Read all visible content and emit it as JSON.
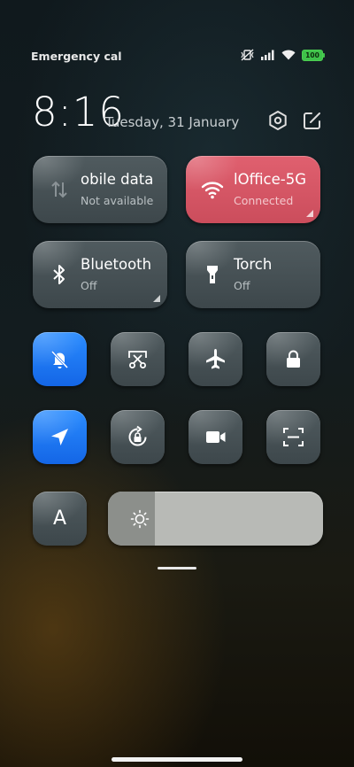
{
  "status_bar": {
    "carrier_text": "Emergency calls o",
    "battery_level": "100",
    "icons": [
      "vibrate-muted-icon",
      "signal-icon",
      "wifi-icon",
      "battery-icon"
    ]
  },
  "header": {
    "time": "8:16",
    "date": "Tuesday, 31 January",
    "icons": [
      "settings-icon",
      "edit-icon"
    ]
  },
  "tiles": {
    "mobile_data": {
      "title": "obile data",
      "subtitle": "Not available",
      "active": false
    },
    "wifi": {
      "title": "lOffice-5G",
      "subtitle": "Connected",
      "active": true,
      "color": "#d65564"
    },
    "bluetooth": {
      "title": "Bluetooth",
      "subtitle": "Off",
      "active": false
    },
    "torch": {
      "title": "Torch",
      "subtitle": "Off",
      "active": false
    }
  },
  "toggles": [
    {
      "name": "mute-toggle",
      "icon": "bell-off-icon",
      "active": true
    },
    {
      "name": "screenshot-toggle",
      "icon": "scissors-icon",
      "active": false
    },
    {
      "name": "airplane-toggle",
      "icon": "airplane-icon",
      "active": false
    },
    {
      "name": "lock-toggle",
      "icon": "lock-icon",
      "active": false
    },
    {
      "name": "location-toggle",
      "icon": "location-arrow-icon",
      "active": true
    },
    {
      "name": "rotation-lock-toggle",
      "icon": "rotation-lock-icon",
      "active": false
    },
    {
      "name": "screen-recorder-toggle",
      "icon": "video-camera-icon",
      "active": false
    },
    {
      "name": "scanner-toggle",
      "icon": "scan-icon",
      "active": false
    }
  ],
  "font_size_button": {
    "label": "A"
  },
  "brightness": {
    "level": 0.22,
    "icon": "sun-icon"
  },
  "colors": {
    "accent_blue": "#1f7cf5",
    "wifi_active": "#d65564"
  }
}
